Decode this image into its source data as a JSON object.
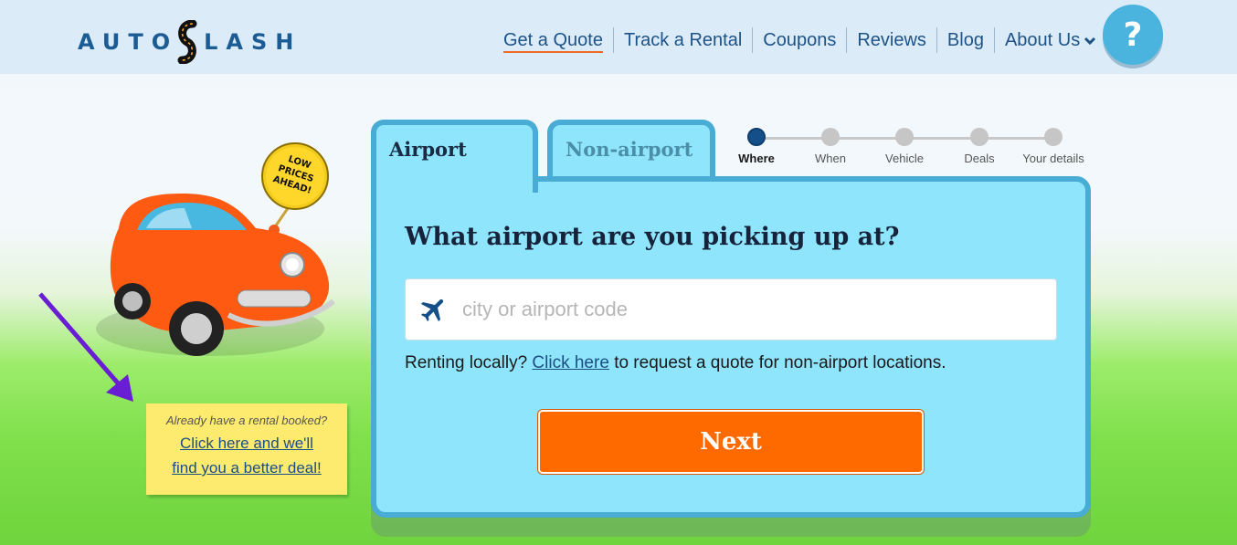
{
  "header": {
    "logo_left": "AUTO",
    "logo_right": "LASH",
    "nav": [
      {
        "label": "Get a Quote",
        "active": true
      },
      {
        "label": "Track a Rental"
      },
      {
        "label": "Coupons"
      },
      {
        "label": "Reviews"
      },
      {
        "label": "Blog"
      },
      {
        "label": "About Us"
      }
    ],
    "help_label": "?"
  },
  "promo": {
    "sign_text": "LOW PRICES AHEAD!",
    "question": "Already have a rental booked?",
    "link_line1": "Click here and we'll",
    "link_line2": "find you a better deal!"
  },
  "tabs": [
    {
      "label": "Airport",
      "active": true
    },
    {
      "label": "Non-airport"
    }
  ],
  "steps": [
    {
      "label": "Where",
      "active": true
    },
    {
      "label": "When"
    },
    {
      "label": "Vehicle"
    },
    {
      "label": "Deals"
    },
    {
      "label": "Your details"
    }
  ],
  "form": {
    "question": "What airport are you picking up at?",
    "search_placeholder": "city or airport code",
    "search_value": "",
    "local_prefix": "Renting locally?",
    "local_link": "Click here",
    "local_suffix": "to request a quote for non-airport locations.",
    "next_label": "Next"
  },
  "colors": {
    "brand_blue": "#1b5c94",
    "accent_orange": "#ff6a00",
    "card_bg": "#8fe5fc",
    "card_border": "#49acd4"
  }
}
